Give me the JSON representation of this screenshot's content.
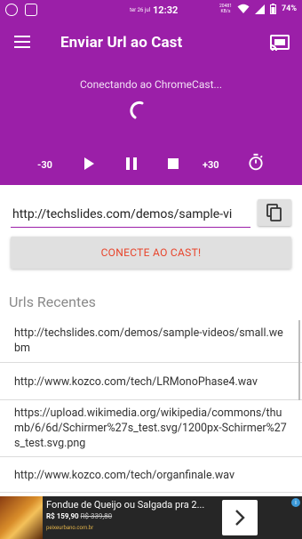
{
  "status_bar": {
    "date": "ter 26 jul",
    "time": "12:32",
    "network_top": "20481",
    "network_bottom": "KB/s",
    "battery": "74%",
    "left_icons": [
      "whatsapp-icon",
      "messenger-icon"
    ],
    "right_icons": [
      "wifi-icon",
      "signal-icon",
      "battery-icon"
    ]
  },
  "app_bar": {
    "title": "Enviar Url ao Cast",
    "icons": [
      "menu-icon",
      "cast-icon"
    ]
  },
  "player": {
    "status": "Conectando ao ChromeCast...",
    "back_label": "-30",
    "forward_label": "+30",
    "icons": [
      "play-icon",
      "pause-icon",
      "stop-icon",
      "timer-icon"
    ]
  },
  "url_field": {
    "value": "http://techslides.com/demos/sample-vi"
  },
  "connect_button": {
    "label": "CONECTE AO CAST!"
  },
  "recent": {
    "title": "Urls Recentes",
    "items": [
      "http://techslides.com/demos/sample-videos/small.webm",
      "http://www.kozco.com/tech/LRMonoPhase4.wav",
      "https://upload.wikimedia.org/wikipedia/commons/thumb/6/6d/Schirmer%27s_test.svg/1200px-Schirmer%27s_test.svg.png",
      "http://www.kozco.com/tech/organfinale.wav"
    ]
  },
  "ad": {
    "title": "Fondue de Queijo ou Salgada pra 2...",
    "price": "R$ 159,90",
    "old_price": "R$ 339,80",
    "domain": "peixeurbano.com.br",
    "info_glyph": "i"
  },
  "colors": {
    "primary": "#9b1fa8",
    "accent_text": "#e8452c",
    "button_bg": "#e0e0e0"
  }
}
